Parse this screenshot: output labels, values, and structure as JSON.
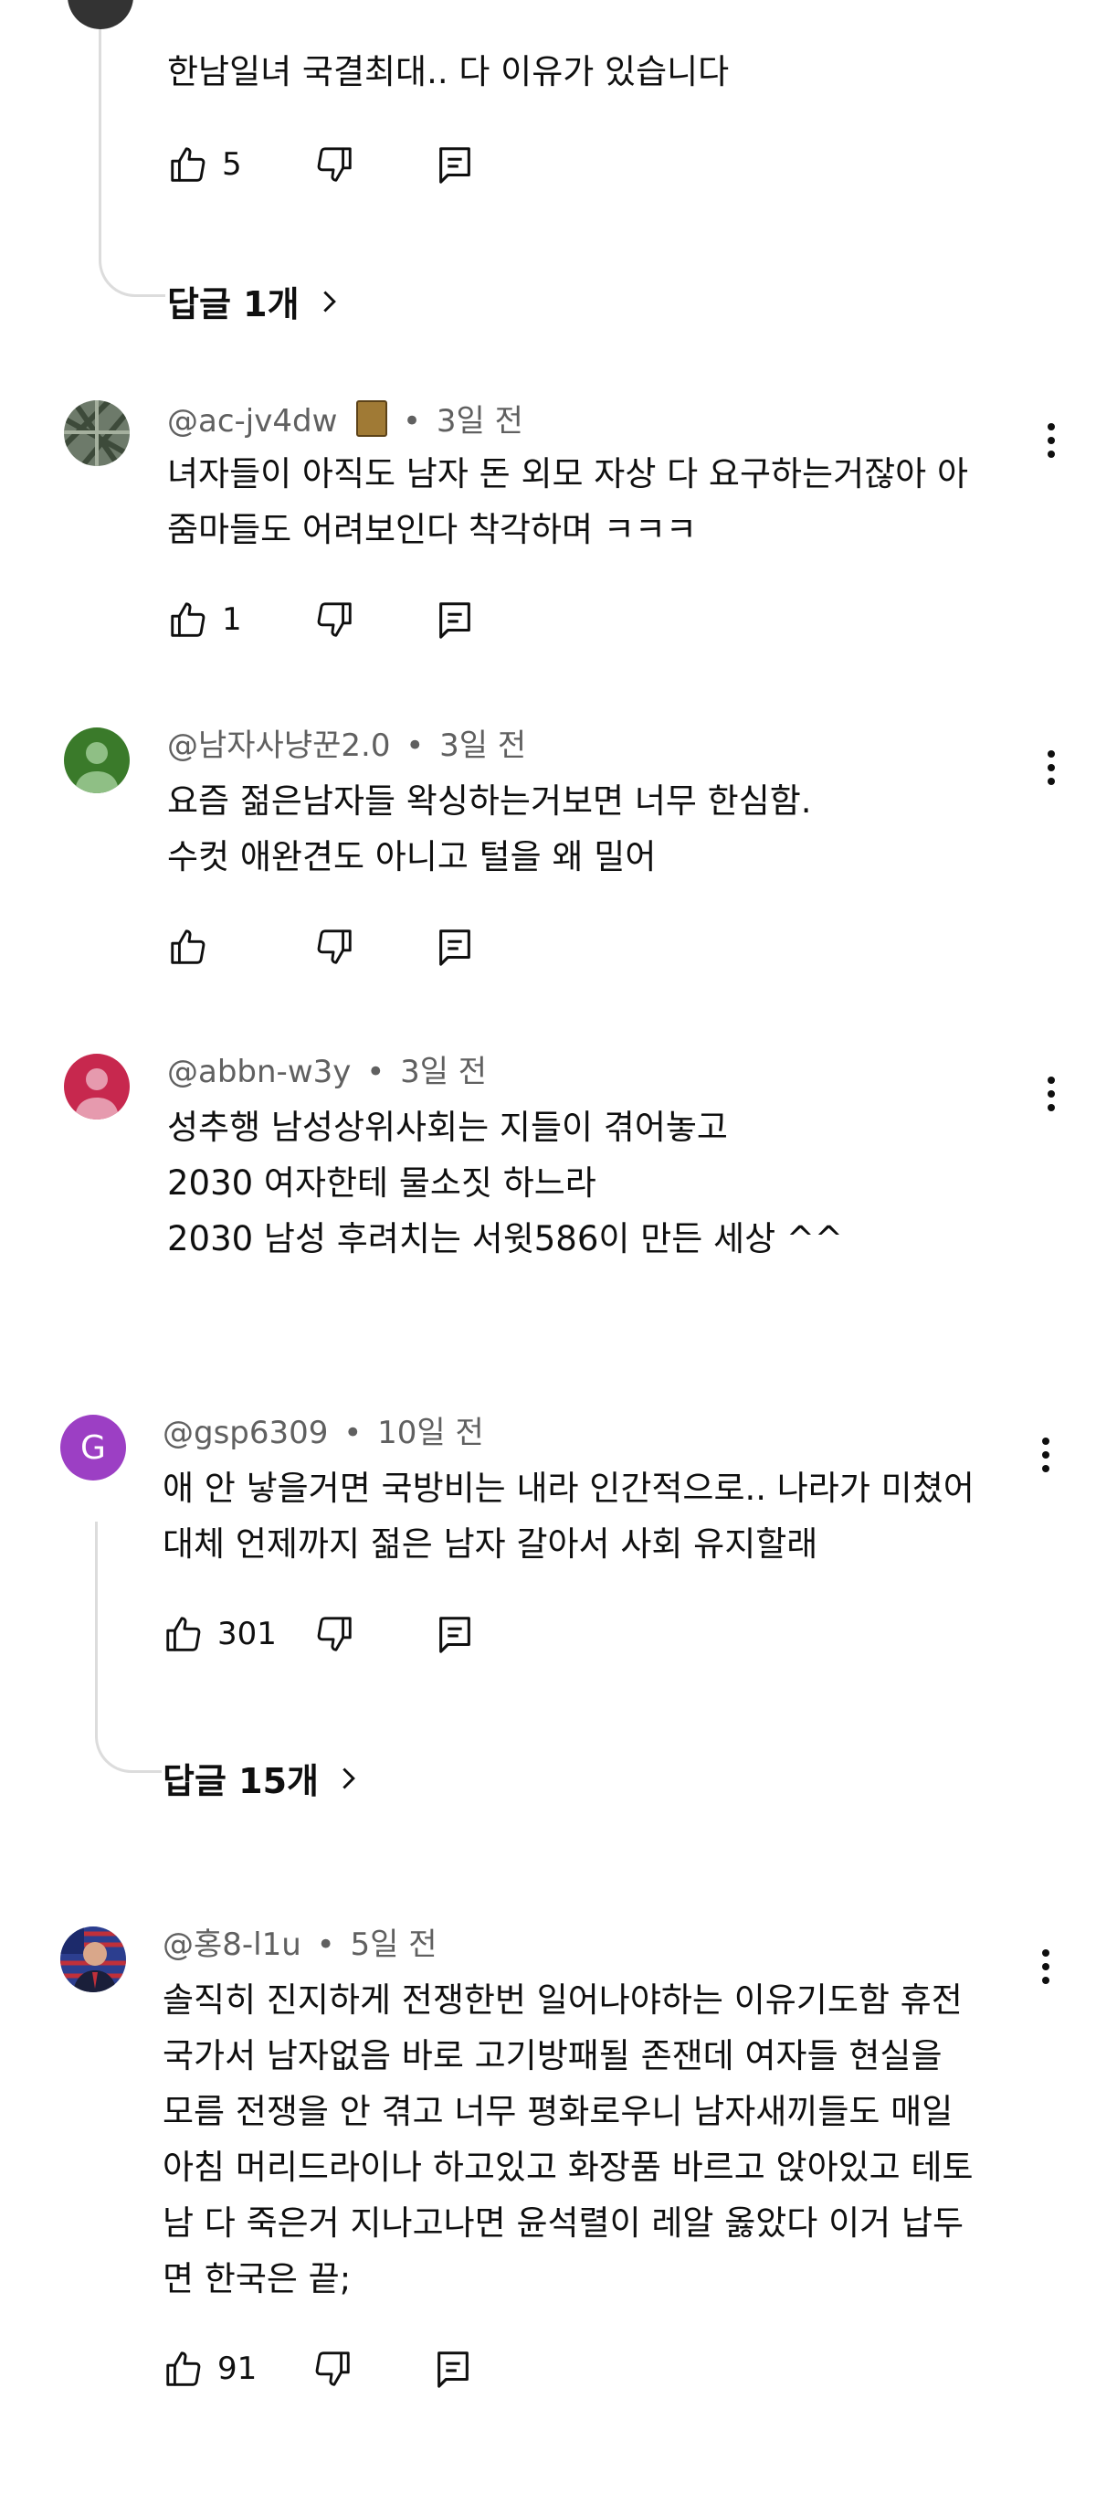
{
  "comments": [
    {
      "text": "한남일녀 국결최대.. 다 이유가 있습니다",
      "likes": "5"
    },
    {
      "author": "@ac-jv4dw",
      "time": "3일 전",
      "text": "녀자들이 아직도 남자 돈 외모 자상 다 요구하는거잖아 아\n줌마들도 어려보인다 착각하며 ㅋㅋㅋ",
      "likes": "1"
    },
    {
      "author": "@남자사냥꾼2.0",
      "time": "3일 전",
      "text": "요즘 젊은남자들 왁싱하는거보면 너무 한심함.\n수컷 애완견도 아니고 털을 왜 밀어",
      "likes": ""
    },
    {
      "author": "@abbn-w3y",
      "time": "3일 전",
      "text": "성추행 남성상위사회는 지들이 겪어놓고\n2030 여자한테 물소짓 하느라\n2030 남성 후려치는 서윗586이 만든 세상 ^^"
    },
    {
      "author": "@gsp6309",
      "time": "10일 전",
      "avatar_letter": "G",
      "text": "애 안 낳을거면 국방비는 내라 인간적으로.. 나라가 미쳤어\n대체 언제까지 젊은 남자 갈아서 사회 유지할래",
      "likes": "301"
    },
    {
      "author": "@홍8-l1u",
      "time": "5일 전",
      "text": "솔직히 진지하게 전쟁한번 일어나야하는 이유기도함 휴전\n국가서 남자없음 바로 고기방패될 존잰데 여자들 현실을\n모름 전쟁을 안 겪고 너무 평화로우니 남자새끼들도 매일\n아침 머리드라이나 하고있고 화장품 바르고 앉아있고 테토\n남 다 죽은거 지나고나면 윤석렬이 레알 옳았다 이거 납두\n면 한국은 끝;",
      "likes": "91"
    }
  ],
  "replies": [
    {
      "label": "답글 1개"
    },
    {
      "label": "답글 15개"
    }
  ],
  "icons": {
    "like": "thumb-up-icon",
    "dislike": "thumb-down-icon",
    "reply": "reply-comment-icon",
    "more": "more-vert-icon",
    "chevron": "chevron-right-icon"
  },
  "colors": {
    "avatar_green": "#3a7a2a",
    "avatar_pink": "#c7284e",
    "avatar_purple": "#9c3fc4",
    "meta_gray": "#606060"
  }
}
